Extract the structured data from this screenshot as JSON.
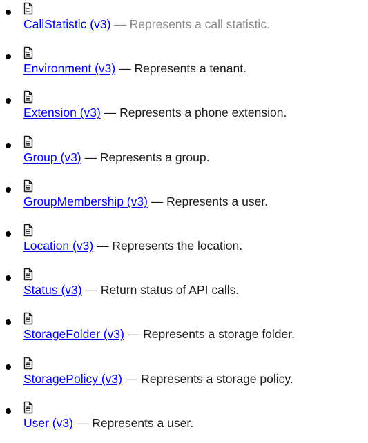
{
  "items": [
    {
      "link": "CallStatistic (v3)",
      "desc": "— Represents a call statistic.",
      "icon": "document-icon"
    },
    {
      "link": "Environment (v3)",
      "desc": "— Represents a tenant.",
      "icon": "document-icon"
    },
    {
      "link": "Extension (v3)",
      "desc": "— Represents a phone extension.",
      "icon": "document-icon"
    },
    {
      "link": "Group (v3)",
      "desc": "— Represents a group.",
      "icon": "document-icon"
    },
    {
      "link": "GroupMembership (v3)",
      "desc": "— Represents a user.",
      "icon": "document-icon"
    },
    {
      "link": "Location (v3)",
      "desc": "— Represents the location.",
      "icon": "document-icon"
    },
    {
      "link": "Status (v3)",
      "desc": "— Return status of API calls.",
      "icon": "document-icon"
    },
    {
      "link": "StorageFolder (v3)",
      "desc": "— Represents a storage folder.",
      "icon": "document-icon"
    },
    {
      "link": "StoragePolicy (v3)",
      "desc": "— Represents a storage policy.",
      "icon": "document-icon"
    },
    {
      "link": "User (v3)",
      "desc": "— Represents a user.",
      "icon": "document-icon"
    }
  ],
  "colors": {
    "link": "#0000ee",
    "text": "#1b1b1b",
    "muted": "#8a8a8a"
  }
}
